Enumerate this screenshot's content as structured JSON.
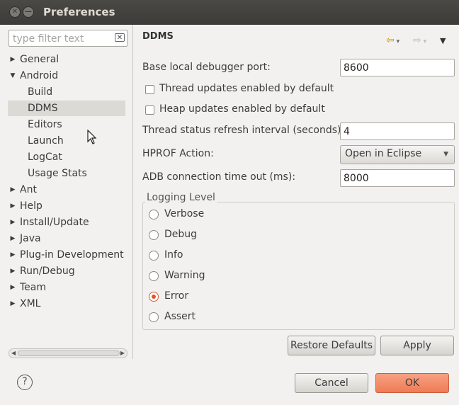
{
  "window": {
    "title": "Preferences"
  },
  "filter": {
    "placeholder": "type filter text"
  },
  "tree": [
    {
      "label": "General",
      "expanded": false
    },
    {
      "label": "Android",
      "expanded": true
    },
    {
      "label": "Build"
    },
    {
      "label": "DDMS",
      "selected": true
    },
    {
      "label": "Editors"
    },
    {
      "label": "Launch"
    },
    {
      "label": "LogCat"
    },
    {
      "label": "Usage Stats"
    },
    {
      "label": "Ant",
      "expanded": false
    },
    {
      "label": "Help",
      "expanded": false
    },
    {
      "label": "Install/Update",
      "expanded": false
    },
    {
      "label": "Java",
      "expanded": false
    },
    {
      "label": "Plug-in Development",
      "expanded": false
    },
    {
      "label": "Run/Debug",
      "expanded": false
    },
    {
      "label": "Team",
      "expanded": false
    },
    {
      "label": "XML",
      "expanded": false
    }
  ],
  "page": {
    "title": "DDMS",
    "debugger_port": {
      "label": "Base local debugger port:",
      "value": "8600"
    },
    "thread_updates": {
      "label": "Thread updates enabled by default",
      "checked": false
    },
    "heap_updates": {
      "label": "Heap updates enabled by default",
      "checked": false
    },
    "thread_refresh": {
      "label": "Thread status refresh interval (seconds):",
      "value": "4"
    },
    "hprof": {
      "label": "HPROF Action:",
      "value": "Open in Eclipse"
    },
    "adb_timeout": {
      "label": "ADB connection time out (ms):",
      "value": "8000"
    },
    "logging": {
      "title": "Logging Level",
      "options": [
        "Verbose",
        "Debug",
        "Info",
        "Warning",
        "Error",
        "Assert"
      ],
      "selected": "Error"
    },
    "restore_defaults": "Restore Defaults",
    "apply": "Apply"
  },
  "footer": {
    "cancel": "Cancel",
    "ok": "OK"
  },
  "colors": {
    "accent": "#ef7b55",
    "radio_selected": "#e5532d"
  }
}
